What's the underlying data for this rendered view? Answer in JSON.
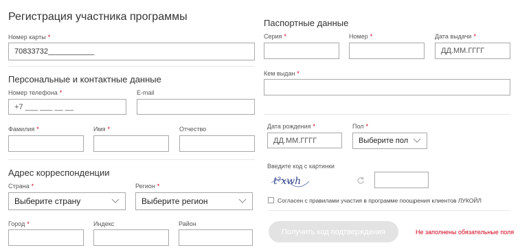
{
  "left": {
    "title": "Регистрация участника программы",
    "card": {
      "label": "Номер карты",
      "value": "70833732___________"
    },
    "personal_title": "Персональные и контактные данные",
    "phone": {
      "label": "Номер телефона",
      "value": "+7 ___ ___ __ __"
    },
    "email": {
      "label": "E-mail"
    },
    "surname": {
      "label": "Фамилия"
    },
    "name": {
      "label": "Имя"
    },
    "patronymic": {
      "label": "Отчество"
    },
    "address_title": "Адрес корреспонденции",
    "country": {
      "label": "Страна",
      "value": "Выберите страну"
    },
    "region": {
      "label": "Регион",
      "value": "Выберите регион"
    },
    "city": {
      "label": "Город"
    },
    "index": {
      "label": "Индекс"
    },
    "district": {
      "label": "Район"
    }
  },
  "right": {
    "passport_title": "Паспортные данные",
    "series": {
      "label": "Серия"
    },
    "number": {
      "label": "Номер"
    },
    "issue_date": {
      "label": "Дата выдачи",
      "placeholder": "ДД.ММ.ГГГГ"
    },
    "issued_by": {
      "label": "Кем выдан"
    },
    "birth_date": {
      "label": "Дата рождения",
      "placeholder": "ДД.ММ.ГГГГ"
    },
    "gender": {
      "label": "Пол",
      "value": "Выберите пол"
    },
    "captcha_label": "Введите код с картинки",
    "captcha_text": "t²xwh",
    "agree_text": "Согласен с правилами участия в программе поощрения клиентов ЛУКОЙЛ",
    "submit_label": "Получить код подтверждения",
    "error_text": "Не заполнены обязательные поля"
  },
  "required_mark": "*",
  "icons": {
    "select": "chevron-down-icon",
    "refresh": "refresh-icon"
  },
  "colors": {
    "required": "#d0021b",
    "border": "#a8a8a8",
    "button_disabled": "#e3e3e3"
  }
}
